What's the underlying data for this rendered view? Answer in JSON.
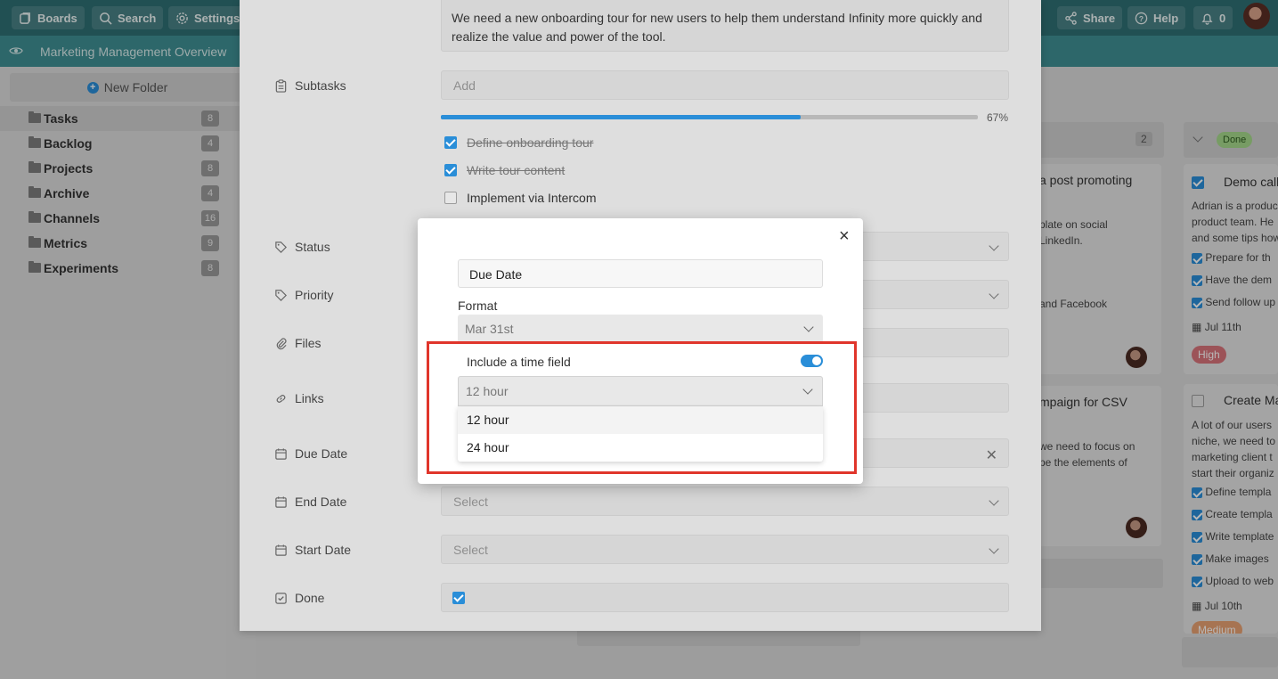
{
  "topbar": {
    "boards": "Boards",
    "search": "Search",
    "settings": "Settings",
    "share": "Share",
    "help": "Help",
    "notifications": "0"
  },
  "board_title": "Marketing Management Overview",
  "sidebar": {
    "new_folder": "New Folder",
    "folders": [
      {
        "name": "Tasks",
        "count": "8"
      },
      {
        "name": "Backlog",
        "count": "4"
      },
      {
        "name": "Projects",
        "count": "8"
      },
      {
        "name": "Archive",
        "count": "4"
      },
      {
        "name": "Channels",
        "count": "16"
      },
      {
        "name": "Metrics",
        "count": "9"
      },
      {
        "name": "Experiments",
        "count": "8"
      }
    ]
  },
  "board": {
    "col1_count": "2",
    "card1": {
      "title": "a post promoting",
      "line1": "plate on social",
      "line2": "LinkedIn.",
      "line3": "and Facebook"
    },
    "card2": {
      "title": "mpaign for CSV",
      "line1": "we need to focus on",
      "line2": "pe the elements of"
    },
    "done_column": {
      "label": "Done",
      "card1": {
        "title": "Demo call",
        "desc1": "Adrian is a produc",
        "desc2": "product team. He",
        "desc3": "and some tips how",
        "items": [
          "Prepare for th",
          "Have the dem",
          "Send follow up"
        ],
        "date": "Jul 11th",
        "priority": "High"
      },
      "card2": {
        "title": "Create Ma",
        "desc1": "A lot of our users",
        "desc2": "niche, we need to",
        "desc3": "marketing client t",
        "desc4": "start their organiz",
        "items": [
          "Define templa",
          "Create templa",
          "Write template",
          "Make images",
          "Upload to web"
        ],
        "date": "Jul 10th",
        "priority": "Medium"
      }
    }
  },
  "panel": {
    "description": "We need a new onboarding tour for new users to help them understand Infinity more quickly and realize the value and power of the tool.",
    "subtasks_label": "Subtasks",
    "subtasks_placeholder": "Add",
    "progress": 0.67,
    "progress_text": "67%",
    "subtasks": [
      {
        "text": "Define onboarding tour",
        "done": true
      },
      {
        "text": "Write tour content",
        "done": true
      },
      {
        "text": "Implement via Intercom",
        "done": false
      }
    ],
    "labels": {
      "status": "Status",
      "priority": "Priority",
      "files": "Files",
      "links": "Links",
      "due_date": "Due Date",
      "end_date": "End Date",
      "start_date": "Start Date",
      "done": "Done"
    },
    "end_date_value": "Select",
    "start_date_value": "Select"
  },
  "modal": {
    "close": "×",
    "name_value": "Due Date",
    "format_label": "Format",
    "format_value": "Mar 31st",
    "toggle_label": "Include a time field",
    "toggle_on": true,
    "time_format_value": "12 hour",
    "options": [
      "12 hour",
      "24 hour"
    ]
  },
  "colors": {
    "accent": "#2a8ed8",
    "topbar": "#2f6f73",
    "highlight": "#e0352b"
  }
}
